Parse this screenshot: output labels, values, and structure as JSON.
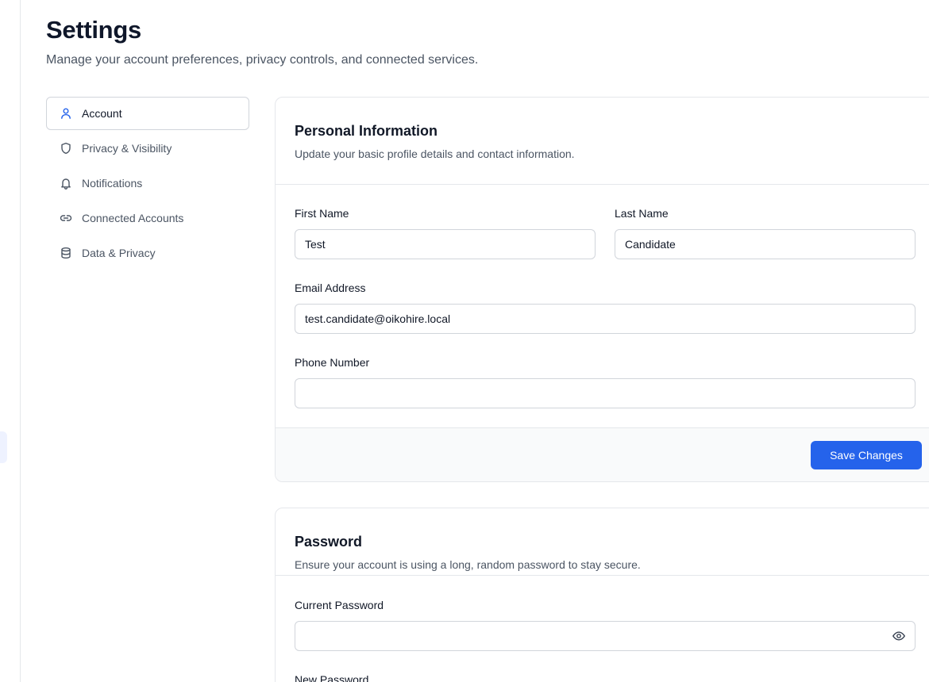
{
  "header": {
    "title": "Settings",
    "subtitle": "Manage your account preferences, privacy controls, and connected services."
  },
  "nav": {
    "items": [
      {
        "label": "Account",
        "icon": "user-icon",
        "active": true
      },
      {
        "label": "Privacy & Visibility",
        "icon": "shield-icon",
        "active": false
      },
      {
        "label": "Notifications",
        "icon": "bell-icon",
        "active": false
      },
      {
        "label": "Connected Accounts",
        "icon": "link-icon",
        "active": false
      },
      {
        "label": "Data & Privacy",
        "icon": "database-icon",
        "active": false
      }
    ]
  },
  "personal": {
    "title": "Personal Information",
    "description": "Update your basic profile details and contact information.",
    "first_name_label": "First Name",
    "first_name_value": "Test",
    "last_name_label": "Last Name",
    "last_name_value": "Candidate",
    "email_label": "Email Address",
    "email_value": "test.candidate@oikohire.local",
    "phone_label": "Phone Number",
    "phone_value": "",
    "save_label": "Save Changes"
  },
  "password": {
    "title": "Password",
    "description": "Ensure your account is using a long, random password to stay secure.",
    "current_label": "Current Password",
    "current_value": "",
    "new_label": "New Password"
  },
  "colors": {
    "accent": "#2563eb",
    "active_icon": "#2563eb",
    "muted_text": "#4b5563",
    "border": "#e5e7eb"
  }
}
